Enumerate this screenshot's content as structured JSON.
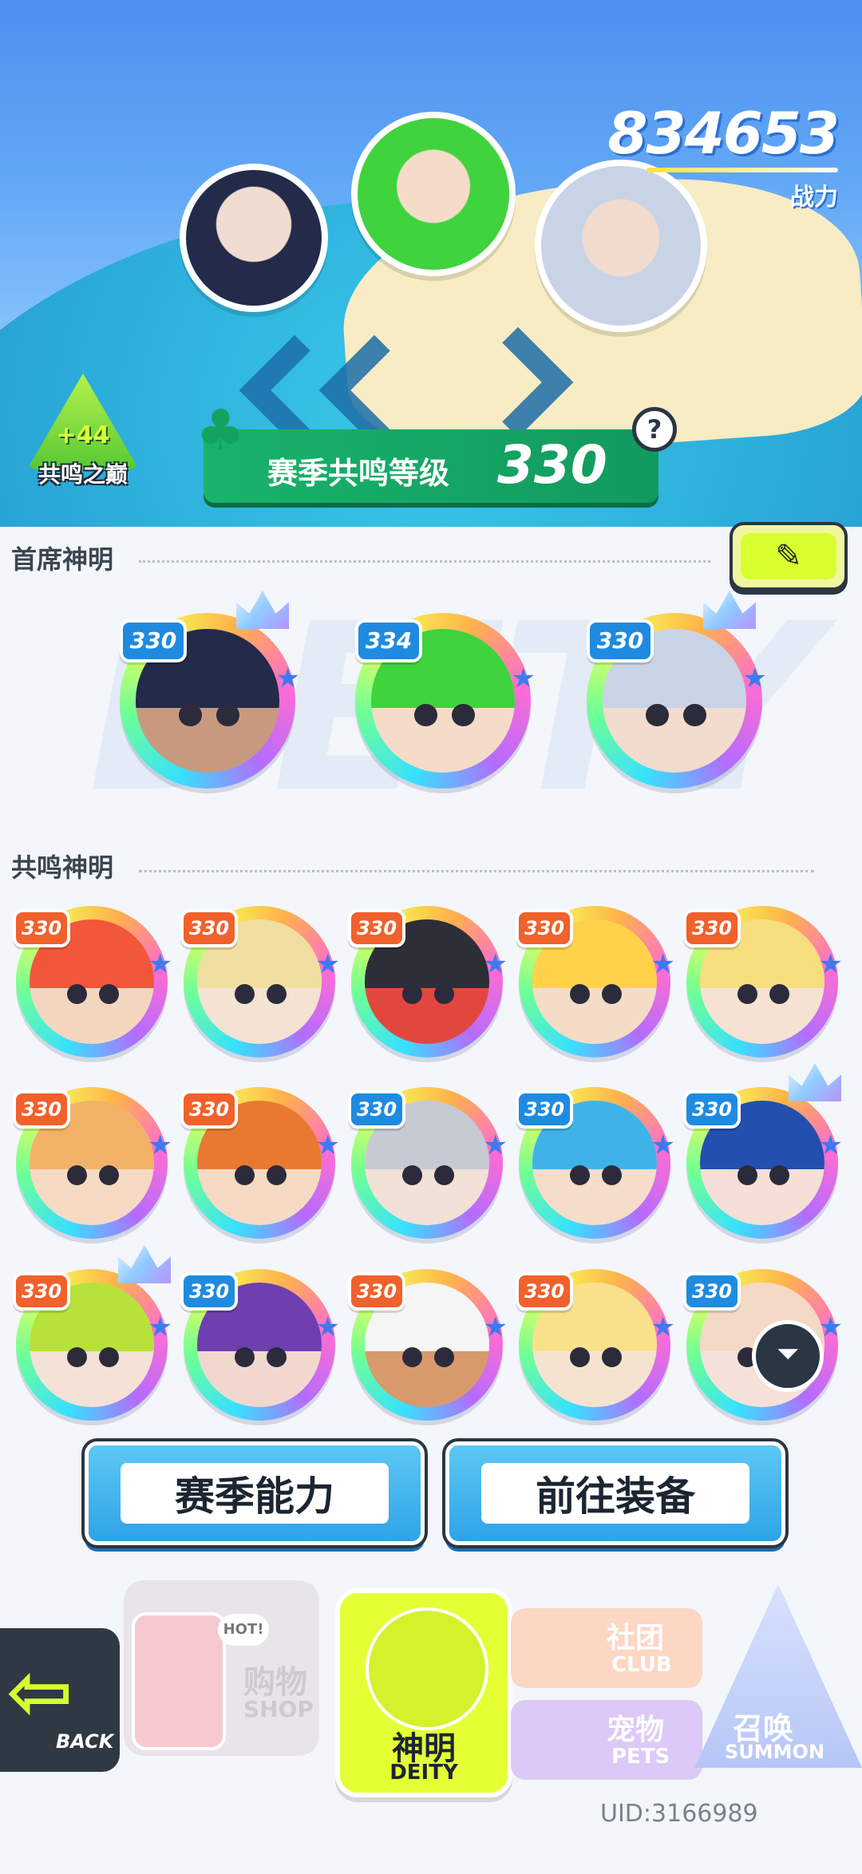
{
  "hero": {
    "power_value": "834653",
    "power_label": "战力",
    "peak_badge": {
      "bonus": "+44",
      "name": "共鸣之巅"
    },
    "season_banner": {
      "label": "赛季共鸣等级",
      "level": "330"
    },
    "help_icon": "question-icon"
  },
  "sections": {
    "leaders_title": "首席神明",
    "resonance_title": "共鸣神明",
    "watermark": "DEITY"
  },
  "leaders": [
    {
      "level": "330",
      "hair": "#232a4a",
      "skin": "#c79a80",
      "crown": true
    },
    {
      "level": "334",
      "hair": "#3fd33d",
      "skin": "#f4dcc9",
      "crown": false
    },
    {
      "level": "330",
      "hair": "#c9d3e6",
      "skin": "#f1dccd",
      "crown": true
    }
  ],
  "resonance": [
    {
      "level": "330",
      "hair": "#f2573a",
      "skin": "#f4d6c0",
      "badge": "red",
      "crown": false
    },
    {
      "level": "330",
      "hair": "#f0dfa0",
      "skin": "#f4e2d2",
      "badge": "red",
      "crown": false
    },
    {
      "level": "330",
      "hair": "#2d2f38",
      "skin": "#e2473f",
      "badge": "red",
      "crown": false
    },
    {
      "level": "330",
      "hair": "#ffd24a",
      "skin": "#f4dcc6",
      "badge": "red",
      "crown": false
    },
    {
      "level": "330",
      "hair": "#f7de7e",
      "skin": "#f5e2d2",
      "badge": "red",
      "crown": false
    },
    {
      "level": "330",
      "hair": "#f1b267",
      "skin": "#f6dac4",
      "badge": "red",
      "crown": false
    },
    {
      "level": "330",
      "hair": "#e77a30",
      "skin": "#f6dac4",
      "badge": "red",
      "crown": false
    },
    {
      "level": "330",
      "hair": "#c5cad3",
      "skin": "#f1e1d6",
      "badge": "blue",
      "crown": false
    },
    {
      "level": "330",
      "hair": "#3fb3e8",
      "skin": "#f5dccb",
      "badge": "blue",
      "crown": false
    },
    {
      "level": "330",
      "hair": "#234fae",
      "skin": "#f6dfd6",
      "badge": "blue",
      "crown": true
    },
    {
      "level": "330",
      "hair": "#b7e23a",
      "skin": "#f4e2d6",
      "badge": "red",
      "crown": true
    },
    {
      "level": "330",
      "hair": "#6f3fb0",
      "skin": "#f0d8cf",
      "badge": "blue",
      "crown": false
    },
    {
      "level": "330",
      "hair": "#f5f5f5",
      "skin": "#d89a6d",
      "badge": "red",
      "crown": false
    },
    {
      "level": "330",
      "hair": "#f9e08a",
      "skin": "#f6e3cf",
      "badge": "red",
      "crown": false
    },
    {
      "level": "330",
      "hair": "#f4d9c6",
      "skin": "#f6e1d8",
      "badge": "blue",
      "crown": false
    }
  ],
  "actions": {
    "season_ability": "赛季能力",
    "go_equip": "前往装备"
  },
  "nav": {
    "back": "BACK",
    "shop_hot": "HOT!",
    "shop_cn": "购物",
    "shop_en": "SHOP",
    "deity_cn": "神明",
    "deity_en": "DEITY",
    "club_cn": "社团",
    "club_en": "CLUB",
    "pets_cn": "宠物",
    "pets_en": "PETS",
    "summon_cn": "召唤",
    "summon_en": "SUMMON"
  },
  "uid": "UID:3166989",
  "colors": {
    "accent_green": "#d9ff2e",
    "ui_dark": "#2a3642",
    "sky": "#4e8ff0"
  }
}
